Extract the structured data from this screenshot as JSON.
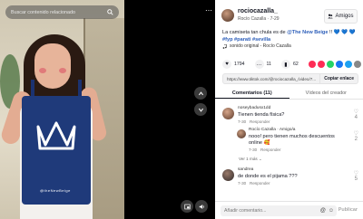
{
  "search": {
    "placeholder": "Buscar contenido relacionado"
  },
  "video": {
    "bag_print": "@theNewBeige"
  },
  "post": {
    "username": "rociocazalla_",
    "subtitle": "Rocío Cazalla · 7-29",
    "friends_label": "Amigos",
    "description": "La camiseta tan chula es de ",
    "mention": "@The New Beige",
    "description_tail": " !! 💙 💙 💙",
    "hashtags": "#fyp #parati #sevilla",
    "sound": "sonido original - Rocío Cazalla"
  },
  "stats": {
    "likes": "1794",
    "comments": "11",
    "saves": "62"
  },
  "url": {
    "text": "https://www.tiktok.com/@rociocazalla_/video/7...",
    "copy": "Copiar enlace"
  },
  "tabs": [
    {
      "label": "Comentarios (11)"
    },
    {
      "label": "Vídeos del creador"
    }
  ],
  "comments": [
    {
      "user": "noseybadusx1dd",
      "text": "Tienen tienda física?",
      "time": "7-30",
      "reply": "Responder",
      "likes": "4"
    },
    {
      "user": "Rocío Cazalla · Amigo/a",
      "text": "nooo! pero tienen muchos descuentos online 🥰",
      "time": "7-30",
      "reply": "Responder",
      "likes": "2"
    },
    {
      "more": "Ver 1 más"
    },
    {
      "user": "sandrea",
      "text": "de donde es el pijama ???",
      "time": "7-30",
      "reply": "Responder",
      "likes": "5"
    }
  ],
  "add_comment": {
    "placeholder": "Añadir comentario...",
    "post": "Publicar"
  },
  "colors": {
    "accent": "#fe2c55",
    "link": "#2b5db9"
  }
}
